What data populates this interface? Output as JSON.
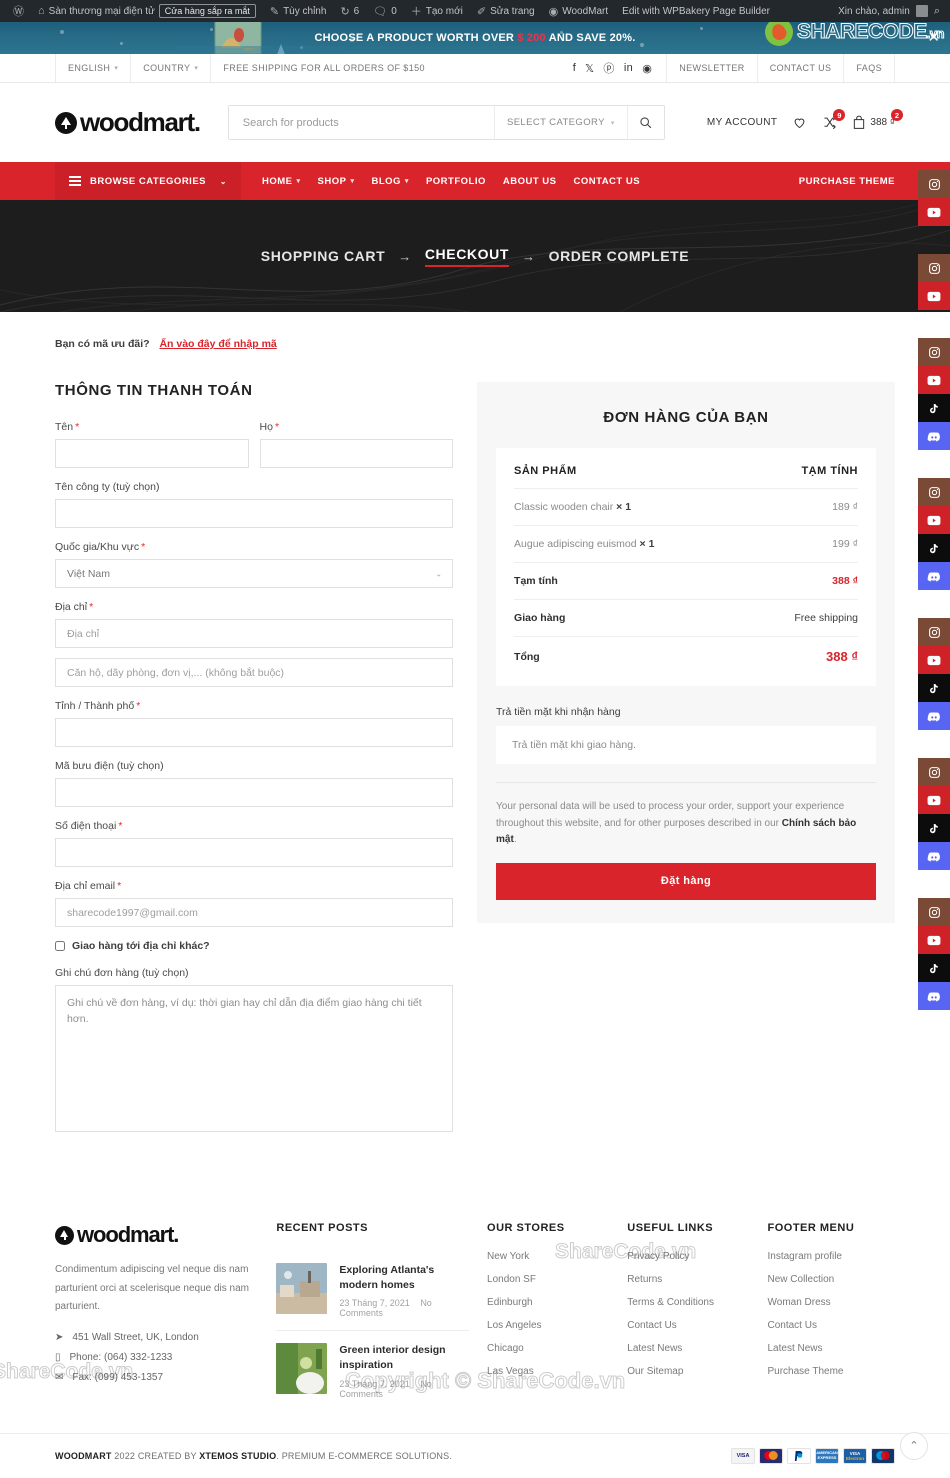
{
  "adminbar": {
    "site_name": "Sàn thương mại điện tử",
    "pill": "Cửa hàng sắp ra mắt",
    "customize": "Tùy chỉnh",
    "updates_count": "6",
    "comments_count": "0",
    "new": "Tạo mới",
    "edit_page": "Sửa trang",
    "theme": "WoodMart",
    "wpbakery": "Edit with WPBakery Page Builder",
    "greeting": "Xin chào, admin"
  },
  "promo": {
    "text_before": "CHOOSE A PRODUCT WORTH OVER",
    "amount": "$ 200",
    "text_after": "AND SAVE 20%.",
    "close": "✕",
    "watermark": "SHARECODE",
    "watermark_tld": ".vn"
  },
  "topbar": {
    "language": "ENGLISH",
    "country": "COUNTRY",
    "shipping_note": "FREE SHIPPING FOR ALL ORDERS OF $150",
    "socials": [
      "facebook-icon",
      "x-twitter-icon",
      "pinterest-icon",
      "linkedin-icon",
      "telegram-icon"
    ],
    "links": [
      "NEWSLETTER",
      "CONTACT US",
      "FAQS"
    ]
  },
  "header": {
    "logo": "woodmart.",
    "search_placeholder": "Search for products",
    "select_category": "SELECT CATEGORY",
    "my_account": "MY ACCOUNT",
    "wishlist_icon": "heart-icon",
    "compare_count": "9",
    "cart_count": "2",
    "cart_amount": "388 ₫"
  },
  "nav": {
    "browse_categories": "BROWSE CATEGORIES",
    "items": [
      {
        "label": "HOME",
        "caret": true
      },
      {
        "label": "SHOP",
        "caret": true
      },
      {
        "label": "BLOG",
        "caret": true
      },
      {
        "label": "PORTFOLIO",
        "caret": false
      },
      {
        "label": "ABOUT US",
        "caret": false
      },
      {
        "label": "CONTACT US",
        "caret": false
      }
    ],
    "purchase_theme": "PURCHASE THEME"
  },
  "hero": {
    "step1": "SHOPPING CART",
    "arrow": "→",
    "step2": "CHECKOUT",
    "step3": "ORDER COMPLETE"
  },
  "coupon": {
    "question": "Bạn có mã ưu đãi?",
    "link": "Ấn vào đây để nhập mã"
  },
  "billing": {
    "title": "THÔNG TIN THANH TOÁN",
    "first_name_label": "Tên",
    "first_name_value": "",
    "last_name_label": "Họ",
    "last_name_value": "",
    "company_label": "Tên công ty (tuỳ chọn)",
    "company_value": "",
    "country_label": "Quốc gia/Khu vực",
    "country_value": "Việt Nam",
    "address_label": "Địa chỉ",
    "address_placeholder": "Địa chỉ",
    "address2_placeholder": "Căn hộ, dãy phòng, đơn vị,... (không bắt buộc)",
    "city_label": "Tỉnh / Thành phố",
    "city_value": "",
    "postcode_label": "Mã bưu điện (tuỳ chọn)",
    "postcode_value": "",
    "phone_label": "Số điện thoại",
    "phone_value": "",
    "email_label": "Địa chỉ email",
    "email_placeholder": "sharecode1997@gmail.com",
    "ship_different": "Giao hàng tới địa chỉ khác?",
    "notes_label": "Ghi chú đơn hàng (tuỳ chọn)",
    "notes_placeholder": "Ghi chú về đơn hàng, ví dụ: thời gian hay chỉ dẫn địa điểm giao hàng chi tiết hơn."
  },
  "order": {
    "title": "ĐƠN HÀNG CỦA BẠN",
    "col_product": "SẢN PHẨM",
    "col_subtotal": "TẠM TÍNH",
    "items": [
      {
        "name": "Classic wooden chair",
        "qty": "× 1",
        "price": "189 ₫"
      },
      {
        "name": "Augue adipiscing euismod",
        "qty": "× 1",
        "price": "199 ₫"
      }
    ],
    "subtotal_label": "Tạm tính",
    "subtotal_value": "388 ₫",
    "shipping_label": "Giao hàng",
    "shipping_value": "Free shipping",
    "total_label": "Tổng",
    "total_value": "388 ₫",
    "payment_method_label": "Trả tiền mặt khi nhận hàng",
    "payment_method_desc": "Trả tiền mặt khi giao hàng.",
    "privacy_text_1": "Your personal data will be used to process your order, support your experience throughout this website, and for other purposes described in our ",
    "privacy_link": "Chính sách bảo mật",
    "privacy_text_2": ".",
    "place_order": "Đặt hàng"
  },
  "footer": {
    "logo": "woodmart.",
    "description": "Condimentum adipiscing vel neque dis nam parturient orci at scelerisque neque dis nam parturient.",
    "address": "451 Wall Street, UK, London",
    "phone": "Phone: (064) 332-1233",
    "fax": "Fax: (099) 453-1357",
    "recent_posts_title": "RECENT POSTS",
    "posts": [
      {
        "title": "Exploring Atlanta's modern homes",
        "date": "23 Tháng 7, 2021",
        "comments": "No Comments"
      },
      {
        "title": "Green interior design inspiration",
        "date": "23 Tháng 7, 2021",
        "comments": "No Comments"
      }
    ],
    "stores_title": "OUR STORES",
    "stores": [
      "New York",
      "London SF",
      "Edinburgh",
      "Los Angeles",
      "Chicago",
      "Las Vegas"
    ],
    "useful_title": "USEFUL LINKS",
    "useful": [
      "Privacy Policy",
      "Returns",
      "Terms & Conditions",
      "Contact Us",
      "Latest News",
      "Our Sitemap"
    ],
    "menu_title": "FOOTER MENU",
    "menu": [
      "Instagram profile",
      "New Collection",
      "Woman Dress",
      "Contact Us",
      "Latest News",
      "Purchase Theme"
    ]
  },
  "bottombar": {
    "copyright_brand": "WOODMART",
    "copyright_rest": " 2022 CREATED BY ",
    "copyright_studio": "XTEMOS STUDIO",
    "copyright_tail": ". PREMIUM E-COMMERCE SOLUTIONS.",
    "cards": [
      "VISA",
      "MC",
      "PayPal",
      "AMEX",
      "VISA Electron",
      "Maestro"
    ],
    "scroll_top_icon": "chevron-up-icon"
  },
  "rail": {
    "groups": 5,
    "items": [
      {
        "name": "instagram-icon",
        "color": "#7a4a36"
      },
      {
        "name": "youtube-icon",
        "color": "#cf2128"
      },
      {
        "name": "tiktok-icon",
        "color": "#0c0c0c"
      },
      {
        "name": "discord-icon",
        "color": "#5865f2"
      }
    ]
  },
  "watermarks": {
    "center": "Copyright © ShareCode.vn",
    "side": "ShareCode.vn"
  },
  "colors": {
    "accent": "#d9242c",
    "nav": "#d9242c",
    "dark": "#1d1d1d",
    "promo": "#276b86"
  }
}
